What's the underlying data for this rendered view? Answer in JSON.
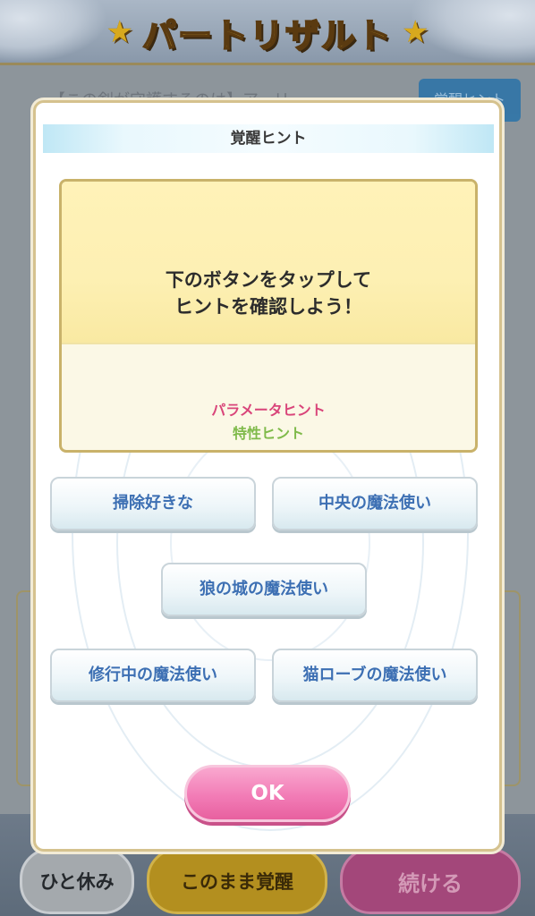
{
  "screen": {
    "title": "パートリザルト",
    "title_star": "★"
  },
  "background": {
    "strip_text": "【この剣が守護するのは】アーリ",
    "hint_button_label": "覚醒ヒント"
  },
  "bottom_bar": {
    "rest_label": "ひと休み",
    "awaken_label": "このまま覚醒",
    "continue_label": "続ける"
  },
  "dialog": {
    "header_title": "覚醒ヒント",
    "message_line1": "下のボタンをタップして",
    "message_line2": "ヒントを確認しよう！",
    "param_hint_label": "パラメータヒント",
    "trait_hint_label": "特性ヒント",
    "choices": [
      "掃除好きな",
      "中央の魔法使い",
      "狼の城の魔法使い",
      "修行中の魔法使い",
      "猫ローブの魔法使い"
    ],
    "ok_label": "OK"
  },
  "colors": {
    "param_hint": "#d9457a",
    "trait_hint": "#7fba4a",
    "choice_text": "#3c6fb3",
    "ok_button": "#f27cb6"
  }
}
